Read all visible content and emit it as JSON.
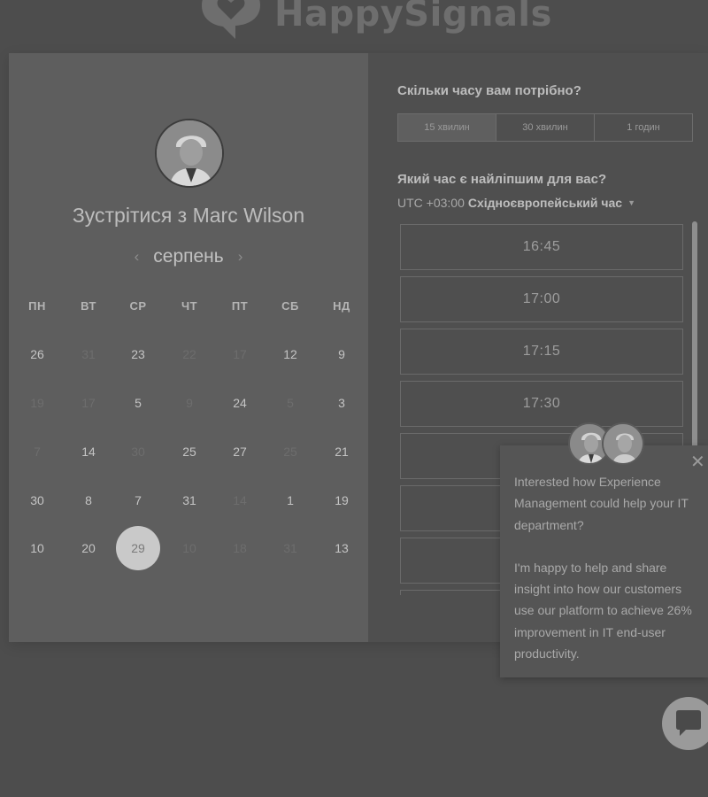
{
  "brand": {
    "name": "HappySignals"
  },
  "booking": {
    "title": "Зустрітися з Marc Wilson",
    "month": "серпень",
    "weekdays": [
      "ПН",
      "ВТ",
      "СР",
      "ЧТ",
      "ПТ",
      "СБ",
      "НД"
    ],
    "weeks": [
      [
        {
          "d": "26",
          "s": "avail"
        },
        {
          "d": "31",
          "s": "muted"
        },
        {
          "d": "23",
          "s": "avail"
        },
        {
          "d": "22",
          "s": "muted"
        },
        {
          "d": "17",
          "s": "muted"
        },
        {
          "d": "12",
          "s": "avail"
        },
        {
          "d": "9",
          "s": "avail"
        }
      ],
      [
        {
          "d": "19",
          "s": "muted"
        },
        {
          "d": "17",
          "s": "muted"
        },
        {
          "d": "5",
          "s": "avail"
        },
        {
          "d": "9",
          "s": "muted"
        },
        {
          "d": "24",
          "s": "avail"
        },
        {
          "d": "5",
          "s": "muted"
        },
        {
          "d": "3",
          "s": "avail"
        }
      ],
      [
        {
          "d": "7",
          "s": "muted"
        },
        {
          "d": "14",
          "s": "avail"
        },
        {
          "d": "30",
          "s": "muted"
        },
        {
          "d": "25",
          "s": "avail"
        },
        {
          "d": "27",
          "s": "avail"
        },
        {
          "d": "25",
          "s": "muted"
        },
        {
          "d": "21",
          "s": "avail"
        }
      ],
      [
        {
          "d": "30",
          "s": "avail"
        },
        {
          "d": "8",
          "s": "avail"
        },
        {
          "d": "7",
          "s": "avail"
        },
        {
          "d": "31",
          "s": "avail"
        },
        {
          "d": "14",
          "s": "muted"
        },
        {
          "d": "1",
          "s": "avail"
        },
        {
          "d": "19",
          "s": "avail"
        }
      ],
      [
        {
          "d": "10",
          "s": "avail"
        },
        {
          "d": "20",
          "s": "avail"
        },
        {
          "d": "29",
          "s": "selected"
        },
        {
          "d": "10",
          "s": "muted"
        },
        {
          "d": "18",
          "s": "muted"
        },
        {
          "d": "31",
          "s": "muted"
        },
        {
          "d": "13",
          "s": "avail"
        }
      ]
    ],
    "duration_question": "Скільки часу вам потрібно?",
    "durations": [
      "15 хвилин",
      "30 хвилин",
      "1 годин"
    ],
    "active_duration": 0,
    "time_question": "Який час є найліпшим для вас?",
    "timezone_offset": "UTC +03:00",
    "timezone_name": "Східноєвропейський час",
    "slots": [
      "16:45",
      "17:00",
      "17:15",
      "17:30",
      "",
      "",
      "",
      ""
    ]
  },
  "chat": {
    "message_1": "Interested how Experience Management could help your IT department?",
    "message_2": "I'm happy to help and share insight into how our customers use our platform to achieve 26% improvement in IT end-user productivity."
  },
  "icons": {
    "logo": "speech-bubble-heart-icon",
    "prev": "chevron-left-icon",
    "next": "chevron-right-icon",
    "close": "close-icon",
    "launcher": "chat-bubble-icon"
  }
}
